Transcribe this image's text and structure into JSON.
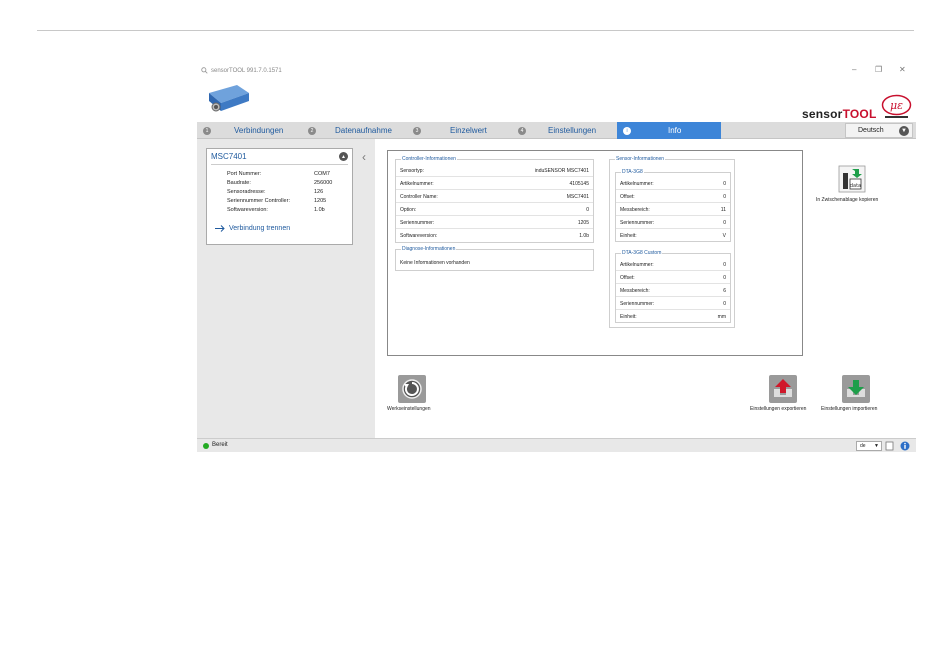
{
  "window": {
    "title": "sensorTOOL 991.7.0.1571",
    "minimize": "–",
    "restore": "❐",
    "close": "✕"
  },
  "brand": {
    "sensor": "sensor",
    "tool": "TOOL"
  },
  "logo": {
    "text": "με"
  },
  "tabs": [
    {
      "label": "Verbindungen",
      "num": "1"
    },
    {
      "label": "Datenaufnahme",
      "num": "2"
    },
    {
      "label": "Einzelwert",
      "num": "3"
    },
    {
      "label": "Einstellungen",
      "num": "4"
    },
    {
      "label": "Info",
      "num": "i"
    }
  ],
  "language": {
    "value": "Deutsch"
  },
  "connection": {
    "title": "MSC7401",
    "rows": [
      {
        "key": "Port Nummer:",
        "value": "COM7"
      },
      {
        "key": "Baudrate:",
        "value": "256000"
      },
      {
        "key": "Sensoradresse:",
        "value": "126"
      },
      {
        "key": "Seriennummer Controller:",
        "value": "1205"
      },
      {
        "key": "Softwareversion:",
        "value": "1.0b"
      }
    ],
    "disconnect_label": "Verbindung trennen"
  },
  "controller_info": {
    "title": "Controller-Informationen",
    "rows": [
      {
        "key": "Sensortyp:",
        "value": "induSENSOR MSC7401"
      },
      {
        "key": "Artikelnummer:",
        "value": "4105145"
      },
      {
        "key": "Controller Name:",
        "value": "MSC7401"
      },
      {
        "key": "Option:",
        "value": "0"
      },
      {
        "key": "Seriennummer:",
        "value": "1205"
      },
      {
        "key": "Softwareversion:",
        "value": "1.0b"
      }
    ]
  },
  "diagnose_info": {
    "title": "Diagnose-Informationen",
    "text": "Keine Informationen vorhanden"
  },
  "sensor_info": {
    "title": "Sensor-Informationen",
    "group1": {
      "title": "DTA-3G8",
      "rows": [
        {
          "key": "Artikelnummer:",
          "value": "0"
        },
        {
          "key": "Offset:",
          "value": "0"
        },
        {
          "key": "Messbereich:",
          "value": "11"
        },
        {
          "key": "Seriennummer:",
          "value": "0"
        },
        {
          "key": "Einheit:",
          "value": "V"
        }
      ]
    },
    "group2": {
      "title": "DTA-3G8 Custom",
      "rows": [
        {
          "key": "Artikelnummer:",
          "value": "0"
        },
        {
          "key": "Offset:",
          "value": "0"
        },
        {
          "key": "Messbereich:",
          "value": "6"
        },
        {
          "key": "Seriennummer:",
          "value": "0"
        },
        {
          "key": "Einheit:",
          "value": "mm"
        }
      ]
    }
  },
  "actions": {
    "copy_clipboard": "In Zwischenablage kopieren",
    "clipboard_icon_text": "data",
    "factory_reset": "Werkseinstellungen",
    "export_settings": "Einstellungen exportieren",
    "import_settings": "Einstellungen importieren"
  },
  "status": {
    "text": "Bereit",
    "lang_code": "de"
  },
  "colors": {
    "accent": "#3d85d8",
    "link": "#1f5a9e",
    "status_ok": "#22aa22",
    "brand_red": "#c8102e"
  }
}
